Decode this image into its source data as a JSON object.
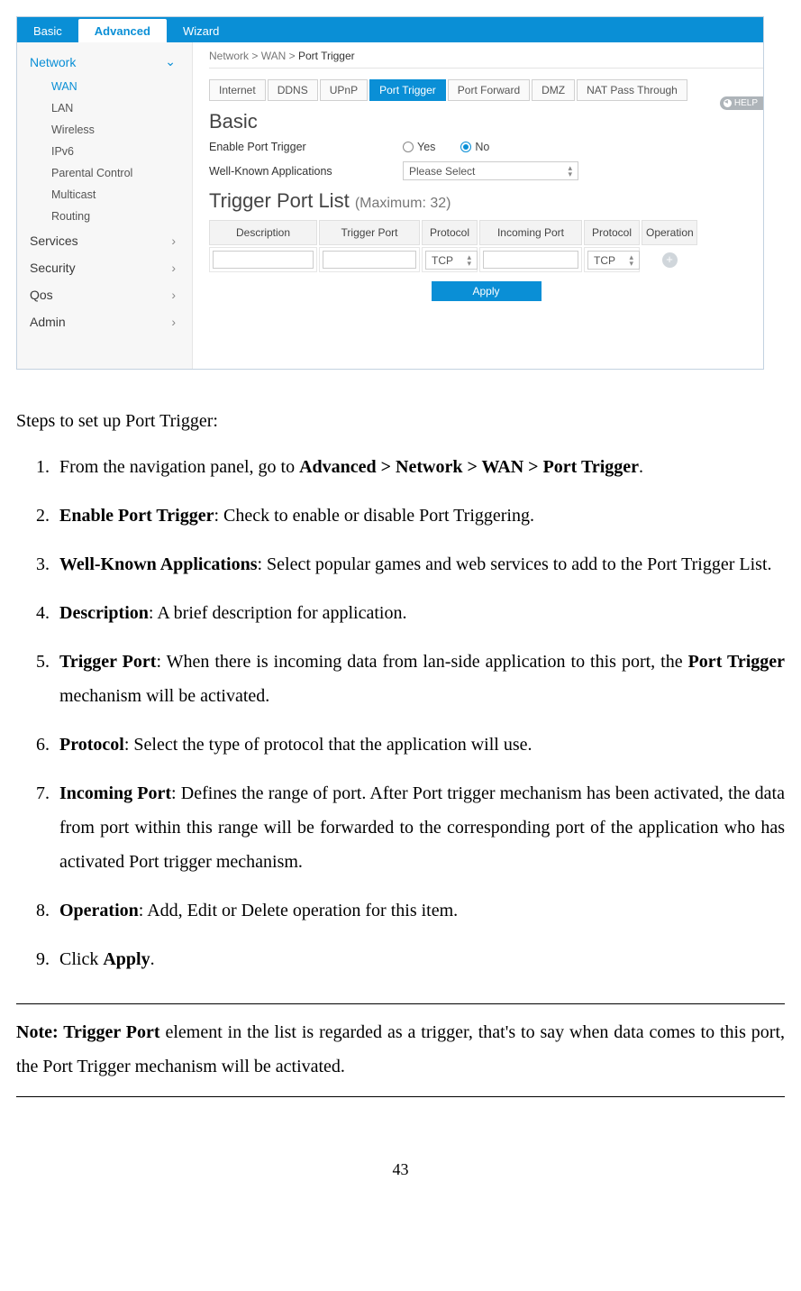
{
  "topbar": {
    "tabs": [
      "Basic",
      "Advanced",
      "Wizard"
    ],
    "active": "Advanced"
  },
  "sidebar": {
    "sections": [
      {
        "label": "Network",
        "open": true,
        "items": [
          "WAN",
          "LAN",
          "Wireless",
          "IPv6",
          "Parental Control",
          "Multicast",
          "Routing"
        ],
        "active": "WAN"
      },
      {
        "label": "Services"
      },
      {
        "label": "Security"
      },
      {
        "label": "Qos"
      },
      {
        "label": "Admin"
      }
    ]
  },
  "breadcrumb": {
    "a": "Network",
    "b": "WAN",
    "c": "Port Trigger"
  },
  "subtabs": [
    "Internet",
    "DDNS",
    "UPnP",
    "Port Trigger",
    "Port Forward",
    "DMZ",
    "NAT Pass Through"
  ],
  "subtab_active": "Port Trigger",
  "help": "HELP",
  "section_basic": "Basic",
  "form": {
    "enable_label": "Enable Port Trigger",
    "yes": "Yes",
    "no": "No",
    "wellknown_label": "Well-Known Applications",
    "wellknown_value": "Please Select"
  },
  "list_title": "Trigger Port List",
  "list_title_suffix": "(Maximum: 32)",
  "columns": [
    "Description",
    "Trigger Port",
    "Protocol",
    "Incoming Port",
    "Protocol",
    "Operation"
  ],
  "protocol_value": "TCP",
  "apply": "Apply",
  "doc": {
    "intro": "Steps to set up Port Trigger:",
    "steps": [
      {
        "pre": "From the navigation panel, go to ",
        "bold": "Advanced > Network > WAN > Port Trigger",
        "post": "."
      },
      {
        "bold": "Enable Port Trigger",
        "post": ": Check to enable or disable Port Triggering."
      },
      {
        "bold": "Well-Known Applications",
        "post": ": Select popular games and web services to add to the Port Trigger List."
      },
      {
        "bold": "Description",
        "post": ": A brief description for application."
      },
      {
        "bold": "Trigger Port",
        "post": ": When there is incoming data from lan-side application to this port, the ",
        "bold2": "Port Trigger",
        "post2": " mechanism will be activated."
      },
      {
        "bold": "Protocol",
        "post": ": Select the type of protocol that the application will use."
      },
      {
        "bold": "Incoming Port",
        "post": ": Defines the range of port. After Port trigger mechanism has been activated, the data from port within this range will be forwarded to the corresponding port of the application who has activated Port trigger mechanism."
      },
      {
        "bold": "Operation",
        "post": ": Add, Edit or Delete operation for this item."
      },
      {
        "pre": "Click ",
        "bold": "Apply",
        "post": "."
      }
    ],
    "note_bold": "Note: Trigger Port",
    "note_rest": " element in the list is regarded as a trigger, that's to say when data comes to this port, the Port Trigger mechanism will be activated."
  },
  "page_number": "43"
}
